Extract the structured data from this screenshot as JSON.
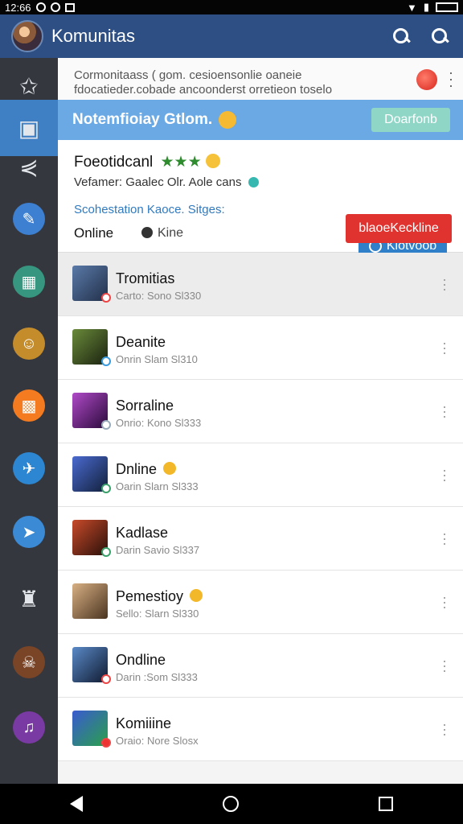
{
  "statusbar": {
    "time": "12:66"
  },
  "appbar": {
    "title": "Komunitas"
  },
  "sidebar": {
    "items": [
      {
        "icon": "star-icon",
        "color": "#34373d"
      },
      {
        "icon": "chat-icon",
        "color": "#3f7fc3"
      },
      {
        "icon": "share-icon",
        "color": "#34373d"
      },
      {
        "icon": "brush-icon",
        "color": "#3d7fd1"
      },
      {
        "icon": "calendar-icon",
        "color": "#36967f"
      },
      {
        "icon": "avatar-icon",
        "color": "#c58c2c"
      },
      {
        "icon": "store-icon",
        "color": "#f47b20"
      },
      {
        "icon": "satellite-icon",
        "color": "#2d86d1"
      },
      {
        "icon": "bird-icon",
        "color": "#3b8ad6"
      },
      {
        "icon": "puzzle-icon",
        "color": "#34373d"
      },
      {
        "icon": "pirate-icon",
        "color": "#7a4426"
      },
      {
        "icon": "music-icon",
        "color": "#7a3aa3"
      }
    ]
  },
  "description": {
    "line1": "Cormonitaass ( gom. cesioensonlie oaneie",
    "line2": "fdocatieder.cobade ancoonderst orretieon toselo"
  },
  "banner": {
    "title": "Notemfioiay Gtlom.",
    "button": "Doarfonb"
  },
  "profile": {
    "name": "Foeotidcanl",
    "stars": "★★★",
    "meta": "Vefamer: Gaalec Olr. Aole cans",
    "stats": "Scohestation Kaoce. Sitges:",
    "status": "Online",
    "kine": "Kine",
    "follow_button": "Kiotvoob",
    "action_button": "blaoeKeckline"
  },
  "list": [
    {
      "name": "Tromitias",
      "sub": "Carto: Sono Sl330",
      "emoji": false,
      "thumb": "#3a4a6b"
    },
    {
      "name": "Deanite",
      "sub": "Onrin Slam Sl310",
      "emoji": false,
      "thumb": "#2e4020"
    },
    {
      "name": "Sorraline",
      "sub": "Onrio: Kono Sl333",
      "emoji": false,
      "thumb": "#5a2a6a"
    },
    {
      "name": "Dnline",
      "sub": "Oarin Slarn Sl333",
      "emoji": true,
      "thumb": "#2a3d72"
    },
    {
      "name": "Kadlase",
      "sub": "Darin Savio Sl337",
      "emoji": false,
      "thumb": "#6a2a1a"
    },
    {
      "name": "Pemestioy",
      "sub": "Sello: Slarn Sl330",
      "emoji": true,
      "thumb": "#7a6046"
    },
    {
      "name": "Ondline",
      "sub": "Darin :Som Sl333",
      "emoji": false,
      "thumb": "#24426e"
    },
    {
      "name": "Komiiine",
      "sub": "Oraio: Nore Slosx",
      "emoji": false,
      "thumb": "#3a7a4a"
    }
  ]
}
